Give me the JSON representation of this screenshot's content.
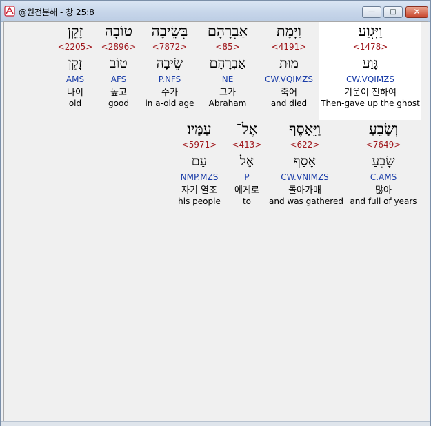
{
  "window": {
    "title": "@원전분해 - 창 25:8",
    "minimize_label": "—",
    "maximize_label": "□",
    "close_label": "✕"
  },
  "words": [
    {
      "hebrew": "וַיִּגְוַע",
      "strong": "<1478>",
      "lemma": "גָּוַע",
      "parse": "CW.VQIMZS",
      "korean": "기운이 진하여",
      "english": "Then-gave up the ghost"
    },
    {
      "hebrew": "וַיָּמָת",
      "strong": "<4191>",
      "lemma": "מוּת",
      "parse": "CW.VQIMZS",
      "korean": "죽어",
      "english": "and died"
    },
    {
      "hebrew": "אַבְרָהָם",
      "strong": "<85>",
      "lemma": "אַבְרָהָם",
      "parse": "NE",
      "korean": "그가",
      "english": "Abraham"
    },
    {
      "hebrew": "בְּשֵׂיבָה",
      "strong": "<7872>",
      "lemma": "שֵׂיבָה",
      "parse": "P.NFS",
      "korean": "수가",
      "english": "in a-old age"
    },
    {
      "hebrew": "טוֹבָה",
      "strong": "<2896>",
      "lemma": "טוֹב",
      "parse": "AFS",
      "korean": "높고",
      "english": "good"
    },
    {
      "hebrew": "זָקֵן",
      "strong": "<2205>",
      "lemma": "זָקֵן",
      "parse": "AMS",
      "korean": "나이",
      "english": "old"
    },
    {
      "hebrew": "וְשָׂבֵעַ",
      "strong": "<7649>",
      "lemma": "שָׂבֵעַ",
      "parse": "C.AMS",
      "korean": "많아",
      "english": "and full of years"
    },
    {
      "hebrew": "וַיֵּאָסֶף",
      "strong": "<622>",
      "lemma": "אָסַף",
      "parse": "CW.VNIMZS",
      "korean": "돌아가매",
      "english": "and was gathered"
    },
    {
      "hebrew": "אֶל־",
      "strong": "<413>",
      "lemma": "אֶל",
      "parse": "P",
      "korean": "에게로",
      "english": "to"
    },
    {
      "hebrew": "עַמָּיו׃",
      "strong": "<5971>",
      "lemma": "עַם",
      "parse": "NMP.MZS",
      "korean": "자기 열조",
      "english": "his people"
    }
  ]
}
